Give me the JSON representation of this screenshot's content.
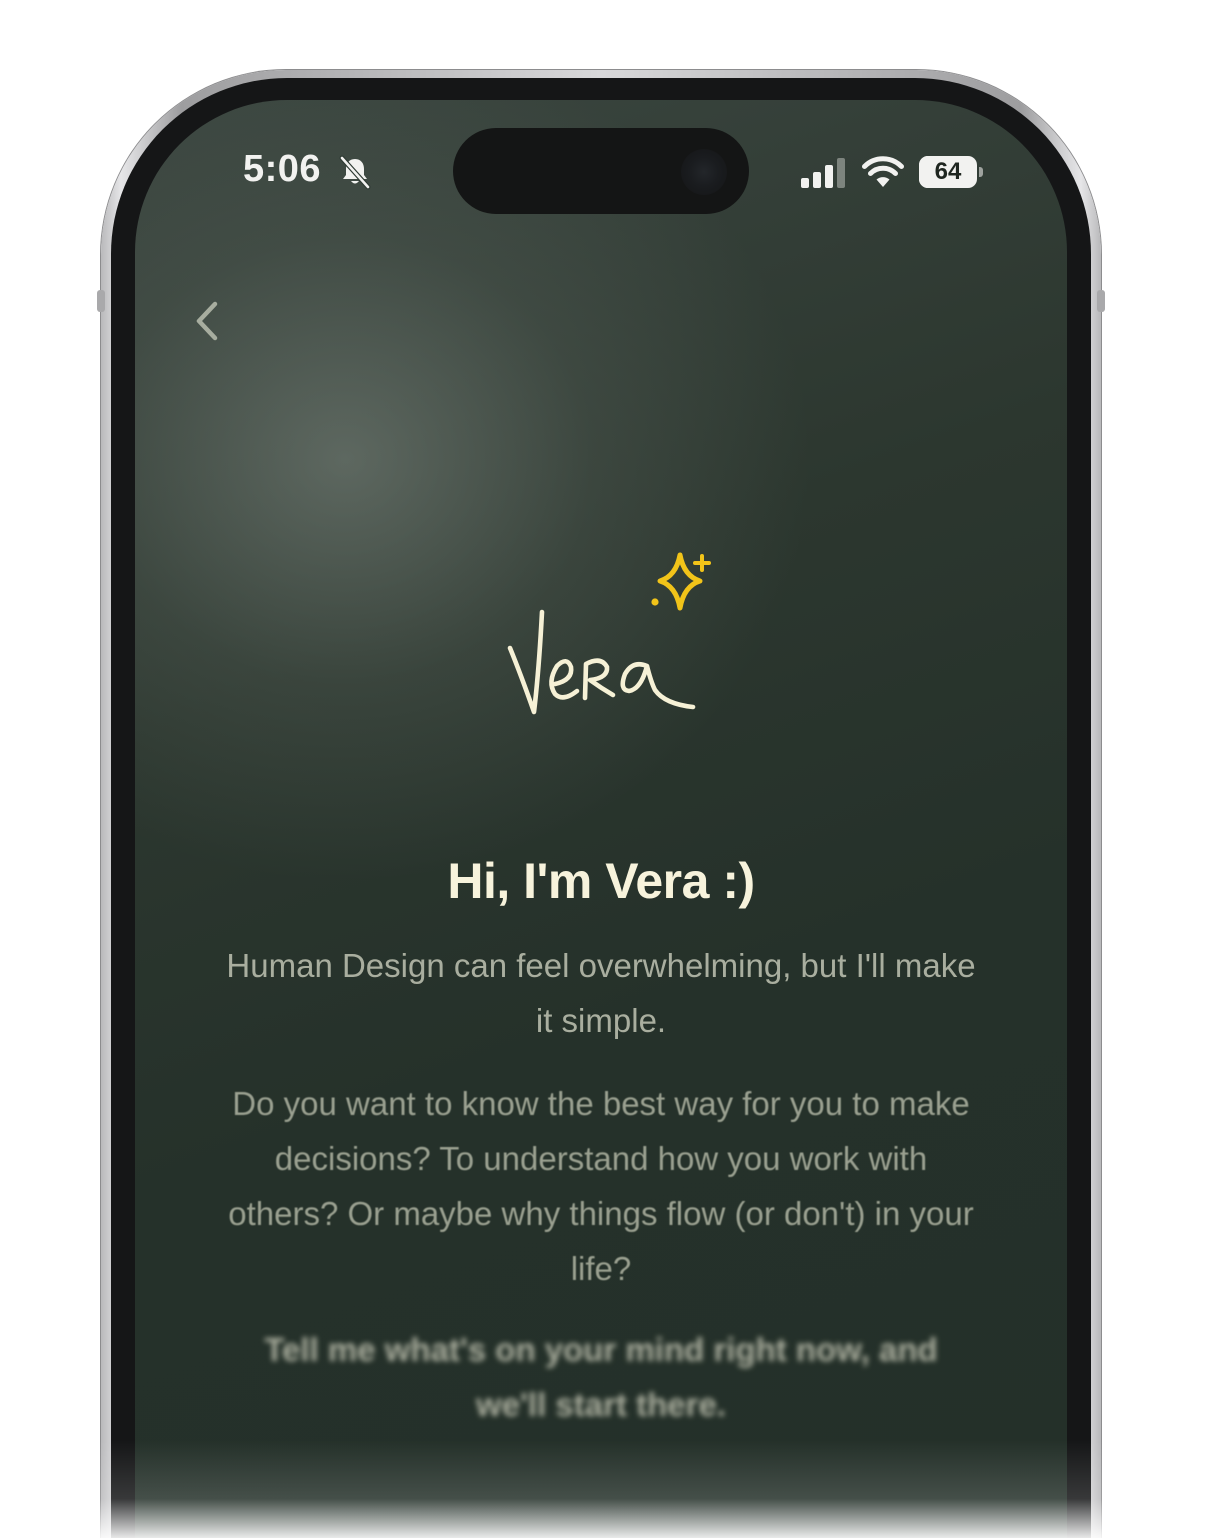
{
  "status_bar": {
    "time": "5:06",
    "battery_percent": "64",
    "battery_level": 0.64,
    "silent_icon": "bell-slash-icon",
    "signal_icon": "cellular-signal-icon",
    "wifi_icon": "wifi-icon"
  },
  "navigation": {
    "back_icon": "chevron-left-icon"
  },
  "logo": {
    "wordmark": "Vera",
    "sparkle_icon": "sparkle-icon",
    "accent_color": "#f2c419",
    "ink_color": "#f6f1d6"
  },
  "content": {
    "heading": "Hi, I'm Vera :)",
    "intro": "Human Design can feel overwhelming, but I'll make it simple.",
    "questions": "Do you want to know the best way for you to make decisions? To understand how you work with others? Or maybe why things flow (or don't) in your life?",
    "call_to_action": "Tell me what's on your mind right now, and we'll start there."
  },
  "theme": {
    "background": "#28332c",
    "heading_color": "#f7f3dc",
    "body_color": "#a9ae9f"
  }
}
